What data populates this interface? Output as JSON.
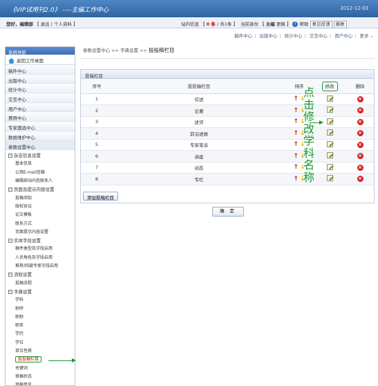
{
  "header": {
    "app_title": "《VIP试用刊2.0》 ----主编工作中心",
    "date": "2012-12-03"
  },
  "infobar": {
    "greeting": "您好，编辑部",
    "logout": "退出",
    "profile": "个人资料",
    "messages_label": "站内信息",
    "messages_count": "0 条",
    "messages_total": "共1条",
    "identity_label": "当前身份",
    "identity_value": "主编",
    "switch": "更换",
    "help": "帮助",
    "feedback": "意见反馈",
    "quit": "换肤"
  },
  "topnav": [
    "稿件中心",
    "出版中心",
    "统计中心",
    "交互中心",
    "用户中心",
    "更多"
  ],
  "sidebar": {
    "title": "系统导航",
    "home": "返回工作桌面",
    "items": [
      "稿件中心",
      "出版中心",
      "统计中心",
      "交互中心",
      "用户中心",
      "费用中心",
      "专家遴选中心",
      "数据维护中心",
      "参数设置中心"
    ],
    "groups": [
      {
        "label": "杂志信息设置",
        "subs": [
          "基本信息",
          "公用E-mail信箱",
          "编辑部站内信联系人"
        ]
      },
      {
        "label": "页面及提示内容设置",
        "subs": [
          "投稿须知",
          "版权协议",
          "论文模板",
          "联系方式",
          "页面提示内容设置"
        ]
      },
      {
        "label": "实体字段设置",
        "subs": [
          "稿件类型及字段启用",
          "人员角色及字段启用",
          "推荐/回避专家字段启用"
        ]
      },
      {
        "label": "流程设置",
        "subs": [
          "投稿流程"
        ]
      },
      {
        "label": "字典设置",
        "subs": [
          "学科",
          "称呼",
          "职称",
          "职务",
          "学历",
          "学位",
          "单位性质",
          "投投稿栏目",
          "关键词",
          "审稿状态",
          "审稿意见"
        ]
      }
    ]
  },
  "breadcrumb": {
    "path1": "参数设置中心",
    "path2": "字典设置",
    "current": "投投稿栏目"
  },
  "panel": {
    "title": "投稿栏目",
    "columns": [
      "序号",
      "投投稿栏目",
      "排序",
      "修改",
      "删除"
    ],
    "rows": [
      {
        "no": "1",
        "name": "综述"
      },
      {
        "no": "2",
        "name": "论著"
      },
      {
        "no": "3",
        "name": "述评"
      },
      {
        "no": "4",
        "name": "前沿进展"
      },
      {
        "no": "5",
        "name": "专家笔谈"
      },
      {
        "no": "6",
        "name": "讲座"
      },
      {
        "no": "7",
        "name": "动态"
      },
      {
        "no": "8",
        "name": "专栏"
      }
    ],
    "add_button": "添加投稿栏目",
    "ok_button": "确 定"
  },
  "annotation": "点击修改学科名称",
  "colors": {
    "annotation": "#1a9a2a",
    "accent": "#2f63a3",
    "alert": "#d60000"
  }
}
